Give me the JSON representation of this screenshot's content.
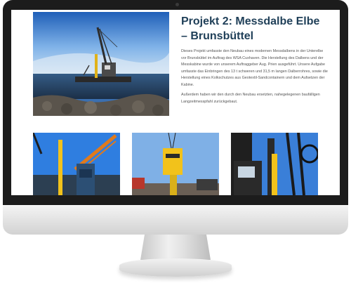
{
  "page": {
    "title": "Projekt 2: Messdalbe Elbe – Brunsbüttel",
    "paragraphs": [
      "Dieses Projekt umfasste den Neubau eines modernen Messdalbens in der Unterelbe vor Brunsbüttel im Auftrag des WSA Cuxhaven. Die Herstellung des Dalbens und der Messkabine wurde von unserem Auftraggeber Aug. Prien ausgeführt. Unsere Aufgabe umfasste das Einbringen des 13 t schweren und 31,5 m langen Dalberrohres, sowie die Herstellung eines Kolkschutzes aus Geotextil-Sandcontainern und dem Aufsetzen der Kabine.",
      "Außerdem haben wir den durch den Neubau ersetzten, nahegelegenen baufälligen Langzeitmesspfahl zurückgebaut."
    ]
  },
  "images": {
    "hero": "floating-crane-barge-photo",
    "gallery": [
      "crane-and-yellow-pile-photo",
      "yellow-pile-hanging-on-crane-photo",
      "pile-driving-rig-photo"
    ]
  },
  "colors": {
    "title": "#1f3f58",
    "body_text": "#555555",
    "bezel": "#1c1c1c",
    "sky": "#3f7ed6"
  }
}
